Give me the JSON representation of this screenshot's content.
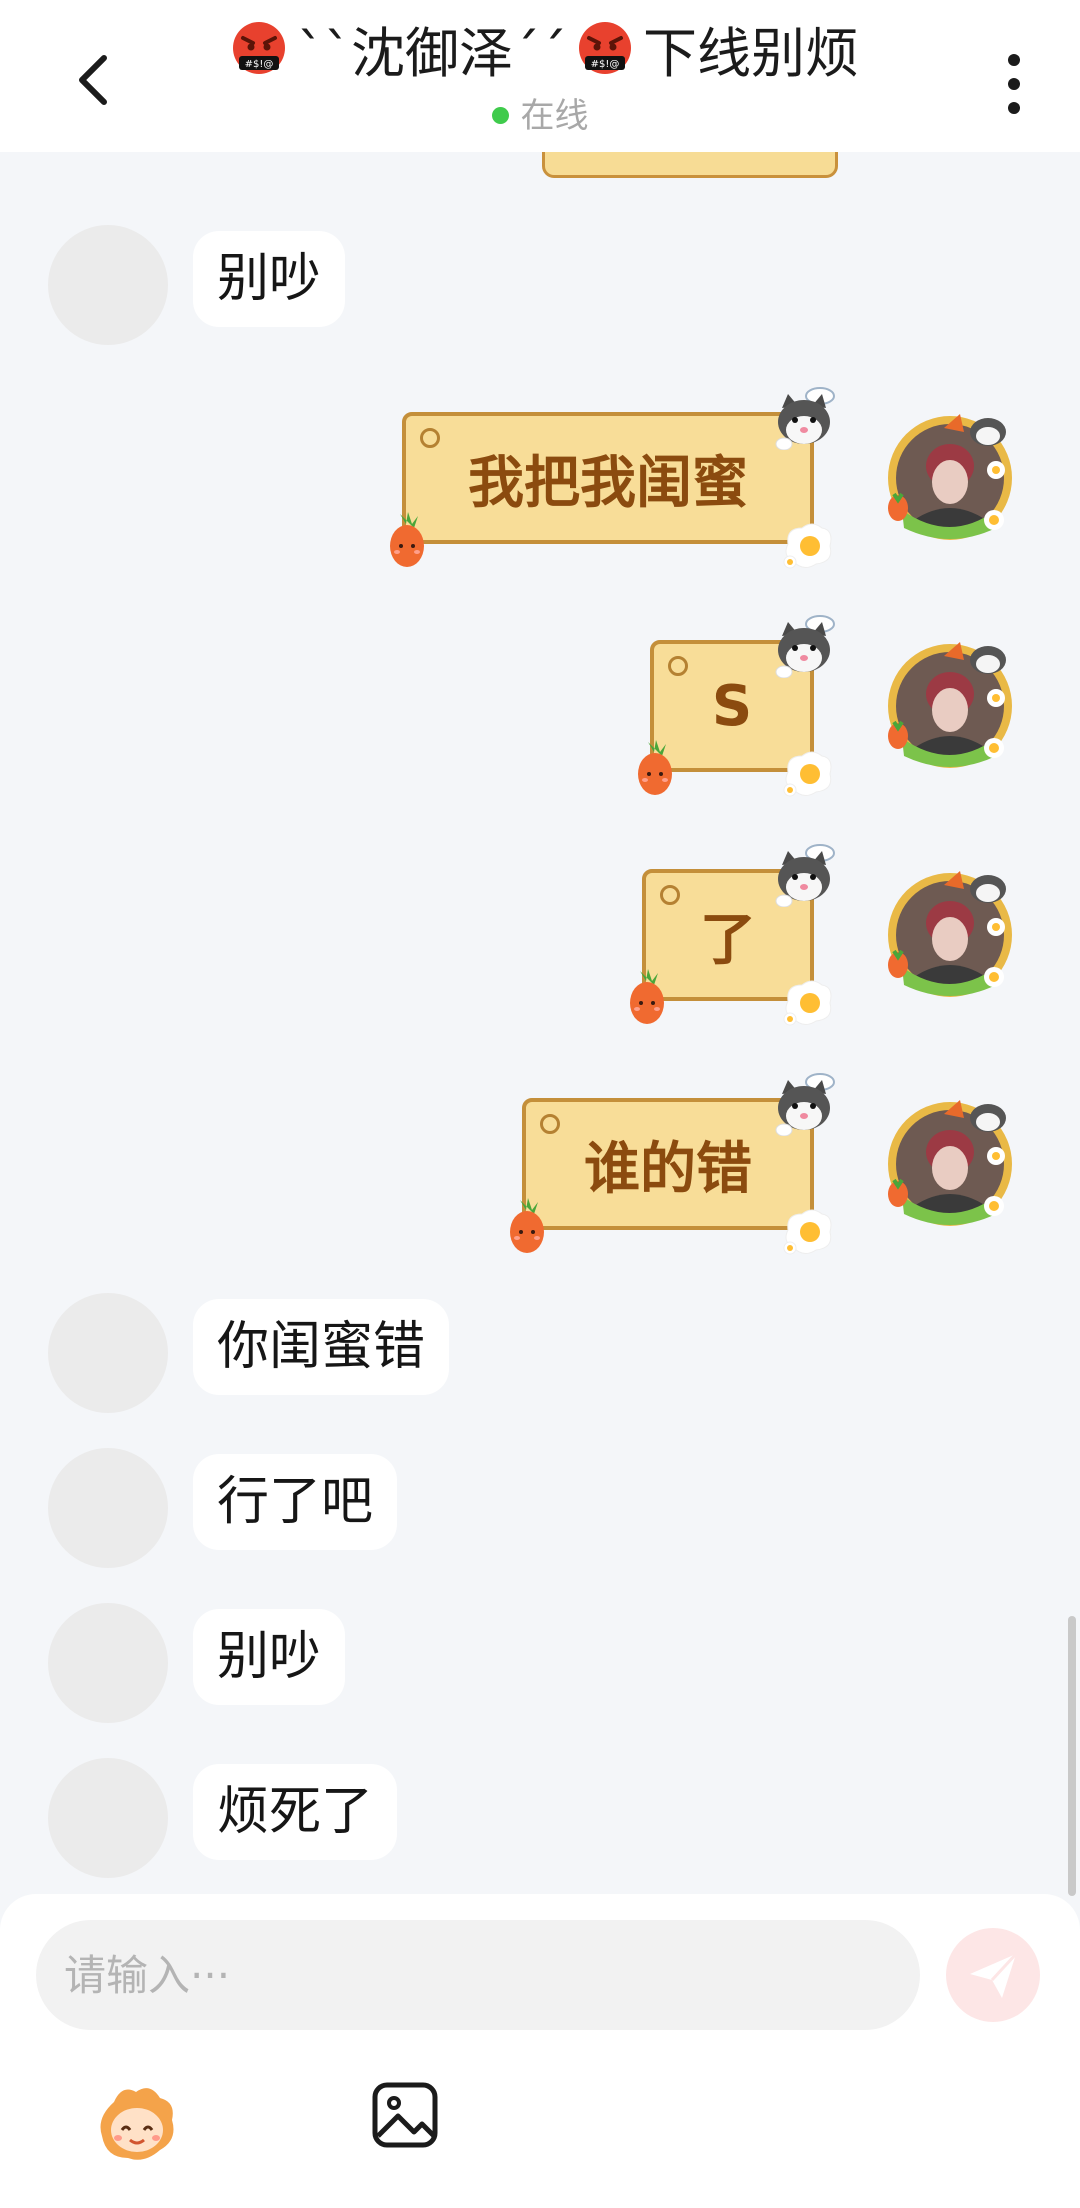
{
  "header": {
    "title_prefix": "``沈御泽´´",
    "title_suffix": "下线别烦",
    "status": "在线"
  },
  "messages": [
    {
      "side": "left",
      "text": "别吵"
    },
    {
      "side": "right",
      "text": "我把我闺蜜"
    },
    {
      "side": "right",
      "text": "S"
    },
    {
      "side": "right",
      "text": "了"
    },
    {
      "side": "right",
      "text": "谁的错"
    },
    {
      "side": "left",
      "text": "你闺蜜错"
    },
    {
      "side": "left",
      "text": "行了吧"
    },
    {
      "side": "left",
      "text": "别吵"
    },
    {
      "side": "left",
      "text": "烦死了"
    }
  ],
  "composer": {
    "placeholder": "请输入···"
  },
  "icons": {
    "back": "chevron-left-icon",
    "more": "more-vertical-icon",
    "send": "send-icon",
    "emoji": "emoji-mascot-icon",
    "image": "image-icon"
  },
  "colors": {
    "online": "#3fcb4c",
    "sticker_fill": "#f8dd98",
    "sticker_text": "#8b4b0f",
    "send_bg": "#fde6e6"
  }
}
